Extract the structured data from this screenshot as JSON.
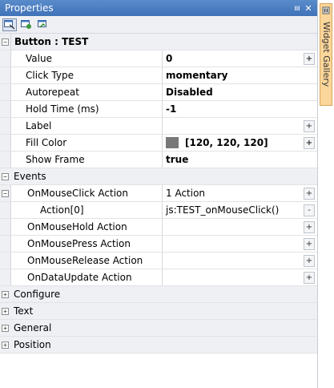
{
  "panel": {
    "title": "Properties",
    "pin_glyph": "⩏",
    "close_glyph": "✕"
  },
  "toolbar": {
    "buttons": [
      {
        "icon": "properties-view-icon"
      },
      {
        "icon": "events-view-icon"
      },
      {
        "icon": "categorized-view-icon"
      }
    ]
  },
  "grid": {
    "header": "Button : TEST",
    "rows": {
      "value": {
        "name": "Value",
        "value": "0"
      },
      "click_type": {
        "name": "Click Type",
        "value": "momentary"
      },
      "autorepeat": {
        "name": "Autorepeat",
        "value": "Disabled"
      },
      "hold_time": {
        "name": "Hold Time (ms)",
        "value": "-1"
      },
      "label": {
        "name": "Label",
        "value": ""
      },
      "fill_color": {
        "name": "Fill Color",
        "value": "[120, 120, 120]",
        "swatch": "#787878"
      },
      "show_frame": {
        "name": "Show Frame",
        "value": "true"
      },
      "events": {
        "name": "Events"
      },
      "onmouseclick": {
        "name": "OnMouseClick Action",
        "value": "1 Action"
      },
      "action0": {
        "name": "Action[0]",
        "value": "js:TEST_onMouseClick()"
      },
      "onmousehold": {
        "name": "OnMouseHold Action",
        "value": ""
      },
      "onmousepress": {
        "name": "OnMousePress Action",
        "value": ""
      },
      "onmouserelease": {
        "name": "OnMouseRelease Action",
        "value": ""
      },
      "ondataupdate": {
        "name": "OnDataUpdate Action",
        "value": ""
      },
      "configure": {
        "name": "Configure"
      },
      "text": {
        "name": "Text"
      },
      "general": {
        "name": "General"
      },
      "position": {
        "name": "Position"
      }
    },
    "expand_glyph": "+",
    "collapse_glyph": "−",
    "add_glyph": "+",
    "remove_glyph": "-"
  },
  "sidebar": {
    "tab_label": "Widget Gallery"
  }
}
